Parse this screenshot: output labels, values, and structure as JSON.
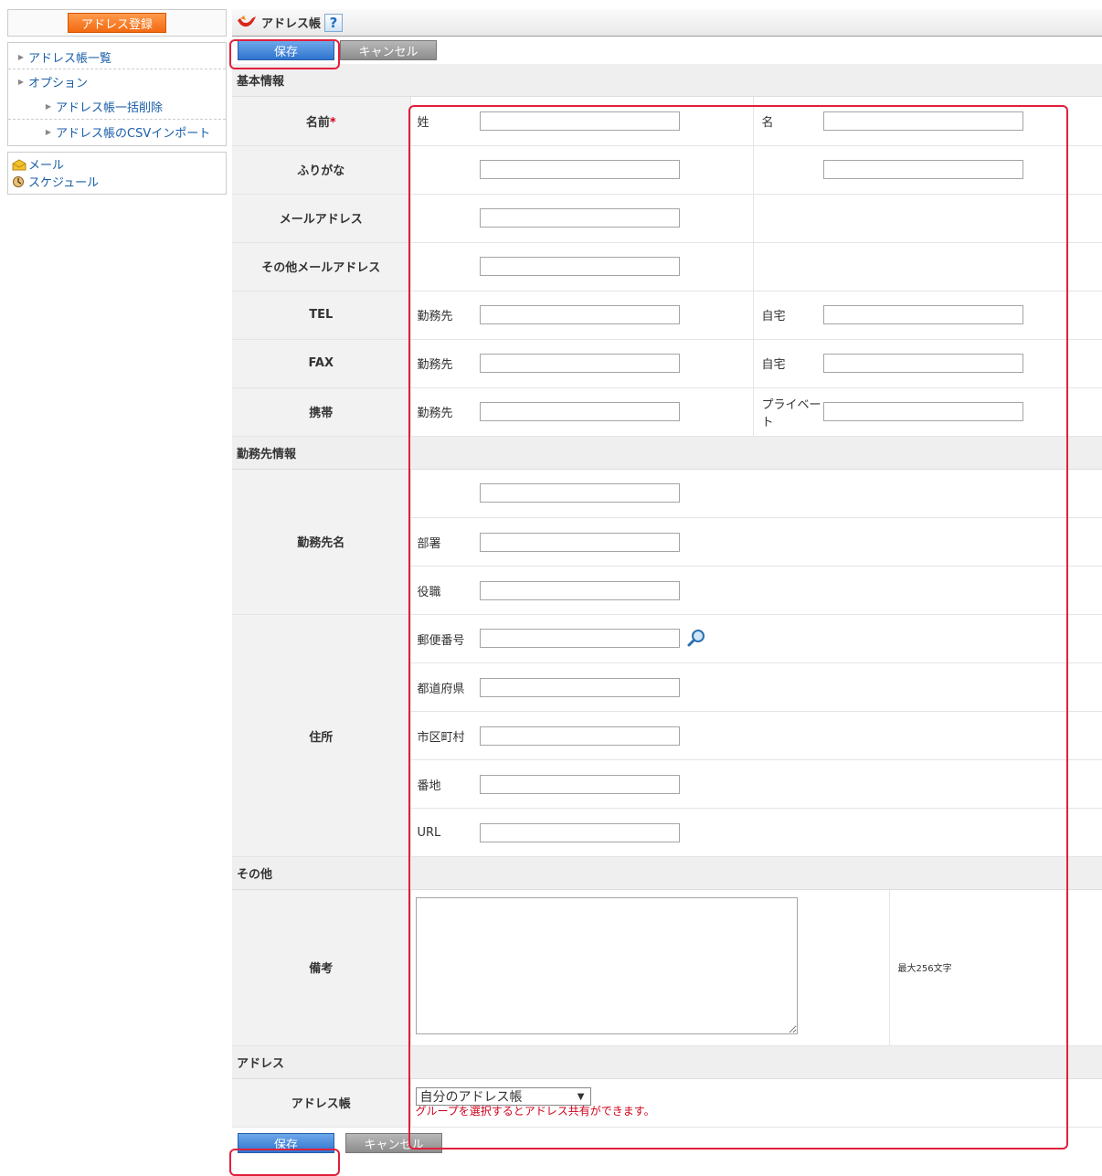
{
  "sidebar": {
    "register_button": "アドレス登録",
    "menu": [
      {
        "label": "アドレス帳一覧"
      },
      {
        "label": "オプション"
      },
      {
        "label": "アドレス帳一括削除"
      },
      {
        "label": "アドレス帳のCSVインポート"
      }
    ],
    "links": [
      {
        "label": "メール",
        "icon": "mail-icon"
      },
      {
        "label": "スケジュール",
        "icon": "schedule-icon"
      }
    ]
  },
  "header": {
    "title": "アドレス帳",
    "help": "?"
  },
  "buttons": {
    "save": "保存",
    "cancel": "キャンセル"
  },
  "sections": {
    "basic": "基本情報",
    "work": "勤務先情報",
    "other": "その他",
    "address": "アドレス"
  },
  "basic": {
    "name_label": "名前",
    "required_mark": "*",
    "last_name": "姓",
    "first_name": "名",
    "furigana_label": "ふりがな",
    "email_label": "メールアドレス",
    "other_email_label": "その他メールアドレス",
    "tel_label": "TEL",
    "fax_label": "FAX",
    "mobile_label": "携帯",
    "work": "勤務先",
    "home": "自宅",
    "private": "プライベート"
  },
  "work": {
    "company_label": "勤務先名",
    "department": "部署",
    "position": "役職",
    "address_label": "住所",
    "zip": "郵便番号",
    "prefecture": "都道府県",
    "city": "市区町村",
    "street": "番地",
    "url": "URL"
  },
  "other": {
    "note_label": "備考",
    "max_length": "最大256文字"
  },
  "addressbook": {
    "label": "アドレス帳",
    "selected": "自分のアドレス帳",
    "hint": "グループを選択するとアドレス共有ができます。"
  },
  "colors": {
    "accent_orange": "#f26a10",
    "save_blue": "#2f74cf",
    "link_blue": "#1a5fa8",
    "highlight_red": "#e0203a",
    "required_red": "#d0021b"
  }
}
